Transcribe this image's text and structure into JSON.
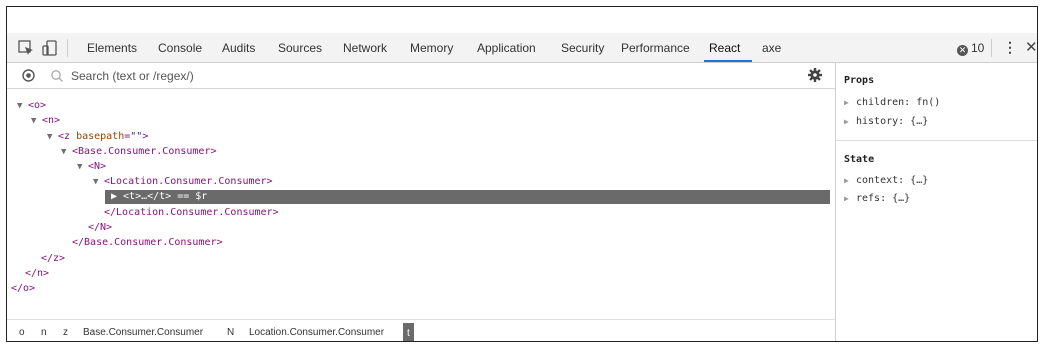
{
  "toolbar": {
    "tabs": [
      {
        "label": "Elements"
      },
      {
        "label": "Console"
      },
      {
        "label": "Audits"
      },
      {
        "label": "Sources"
      },
      {
        "label": "Network"
      },
      {
        "label": "Memory"
      },
      {
        "label": "Application"
      },
      {
        "label": "Security"
      },
      {
        "label": "Performance"
      },
      {
        "label": "React",
        "active": true
      },
      {
        "label": "axe"
      }
    ],
    "error_count": "10",
    "kebab_label": "⋮",
    "close_label": "✕"
  },
  "search": {
    "placeholder": "Search (text or /regex/)",
    "value": ""
  },
  "tree": {
    "lines": [
      {
        "tri": "▼",
        "text": "<o>"
      },
      {
        "tri": "▼",
        "text": "<n>"
      },
      {
        "tri": "▼",
        "tag_open": "<z ",
        "attr_name": "basepath",
        "attr_eq": "=",
        "attr_val": "\"\"",
        "tag_close": ">"
      },
      {
        "tri": "▼",
        "text": "<Base.Consumer.Consumer>"
      },
      {
        "tri": "▼",
        "text": "<N>"
      },
      {
        "tri": "▼",
        "text": "<Location.Consumer.Consumer>"
      },
      {
        "tri": "",
        "text": "</Location.Consumer.Consumer>"
      },
      {
        "tri": "",
        "text": "</N>"
      },
      {
        "tri": "",
        "text": "</Base.Consumer.Consumer>"
      },
      {
        "tri": "",
        "text": "</z>"
      },
      {
        "tri": "",
        "text": "</n>"
      },
      {
        "tri": "",
        "text": "</o>"
      }
    ],
    "selected": "▶ <t>…</t> == $r"
  },
  "props": {
    "title": "Props",
    "items": [
      {
        "tri": "▶",
        "text": "children: fn()"
      },
      {
        "tri": "▶",
        "text": "history: {…}"
      }
    ]
  },
  "state": {
    "title": "State",
    "items": [
      {
        "tri": "▶",
        "text": "context: {…}"
      },
      {
        "tri": "▶",
        "text": "refs: {…}"
      }
    ]
  },
  "breadcrumb": {
    "items": [
      {
        "label": "o"
      },
      {
        "label": "n"
      },
      {
        "label": "z"
      },
      {
        "label": "Base.Consumer.Consumer"
      },
      {
        "label": "N"
      },
      {
        "label": "Location.Consumer.Consumer"
      },
      {
        "label": "t",
        "active": true
      }
    ]
  }
}
